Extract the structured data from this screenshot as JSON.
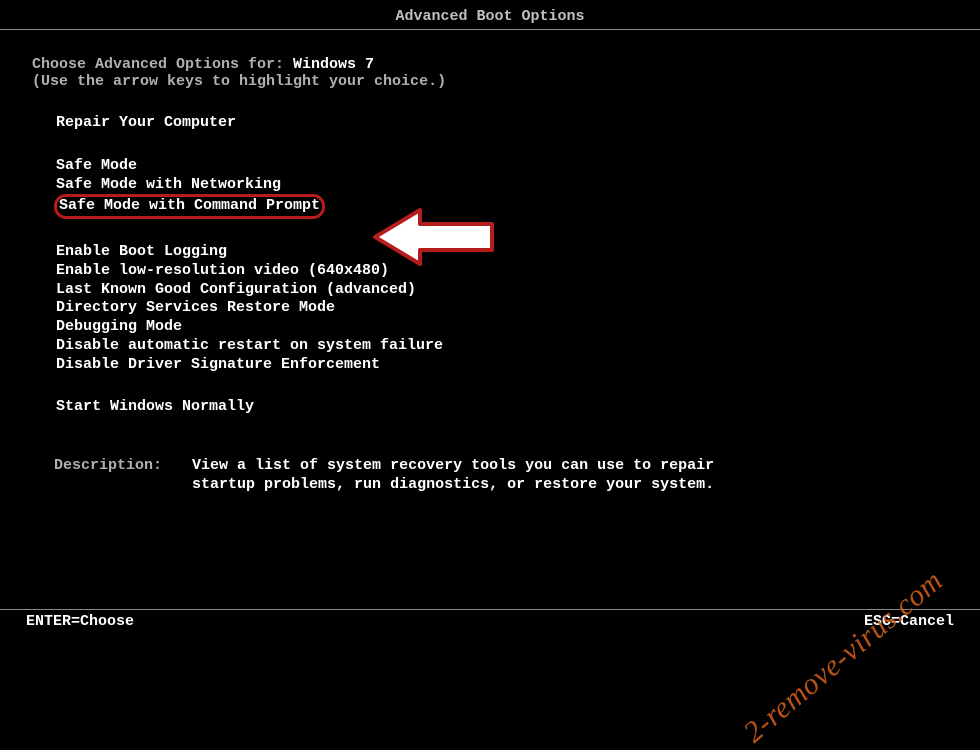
{
  "title": "Advanced Boot Options",
  "choose_text": "Choose Advanced Options for: ",
  "os_name": "Windows 7",
  "hint": "(Use the arrow keys to highlight your choice.)",
  "group1": {
    "repair": "Repair Your Computer"
  },
  "group2": {
    "safe": "Safe Mode",
    "safe_net": "Safe Mode with Networking",
    "safe_cmd": "Safe Mode with Command Prompt"
  },
  "group3": {
    "bootlog": "Enable Boot Logging",
    "lowres": "Enable low-resolution video (640x480)",
    "lkgc": "Last Known Good Configuration (advanced)",
    "dsrm": "Directory Services Restore Mode",
    "debug": "Debugging Mode",
    "noautoreboot": "Disable automatic restart on system failure",
    "nodrvsig": "Disable Driver Signature Enforcement"
  },
  "group4": {
    "normal": "Start Windows Normally"
  },
  "description_label": "Description:",
  "description_text": "View a list of system recovery tools you can use to repair startup problems, run diagnostics, or restore your system.",
  "footer": {
    "enter": "ENTER=Choose",
    "esc": "ESC=Cancel"
  },
  "watermark": "2-remove-virus.com"
}
